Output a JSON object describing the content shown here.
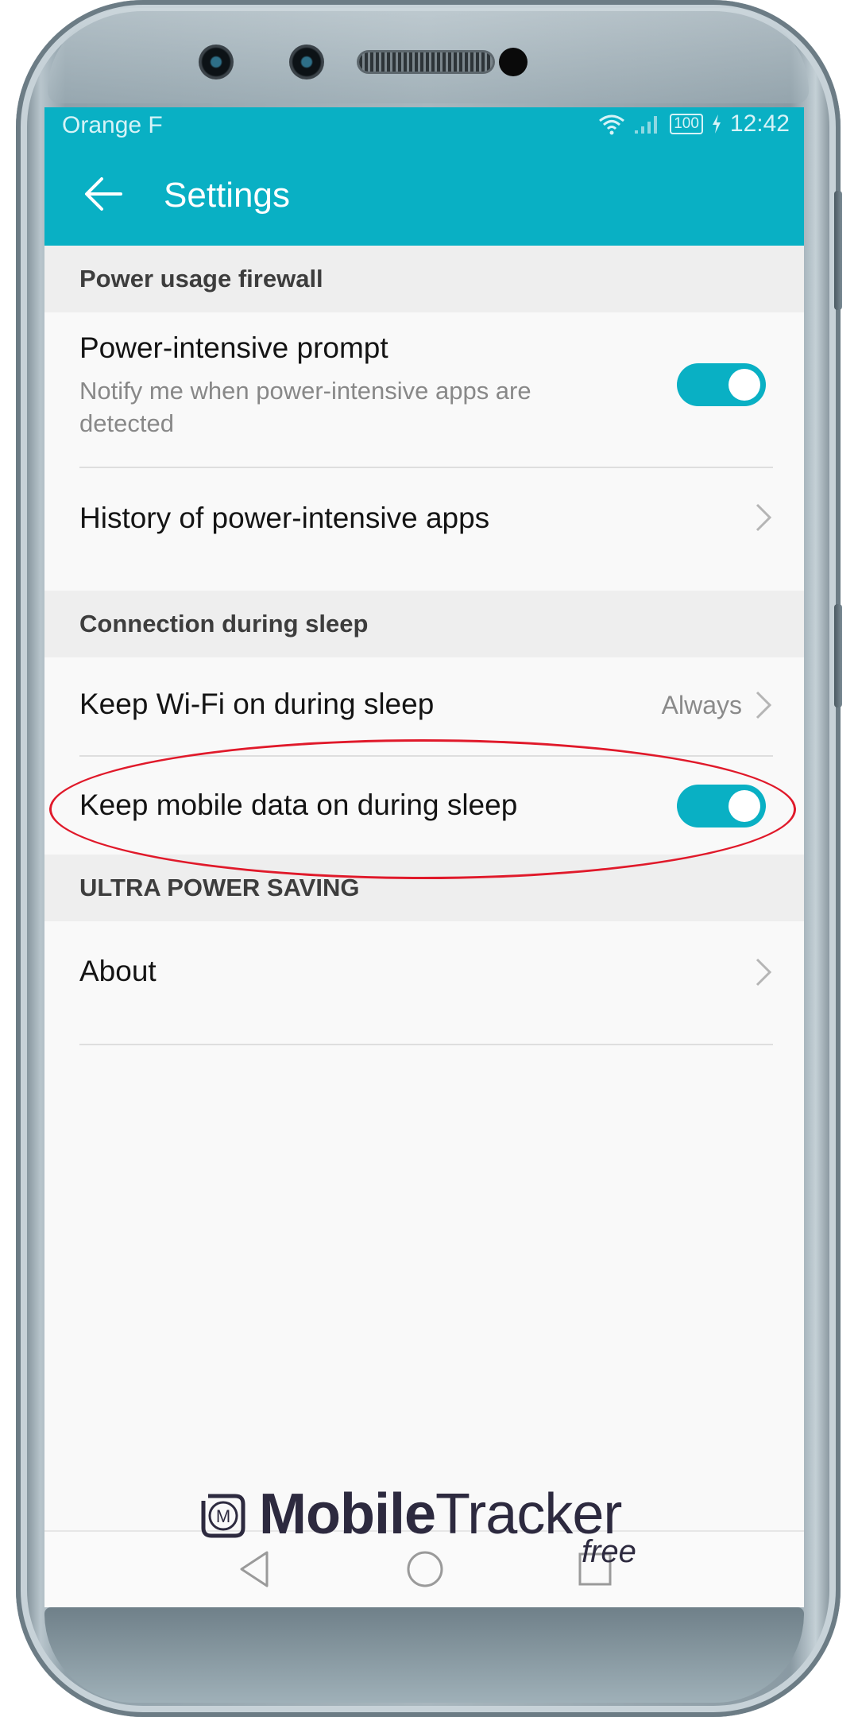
{
  "status_bar": {
    "carrier": "Orange F",
    "battery": "100",
    "time": "12:42",
    "icons": [
      "wifi-icon",
      "signal-icon",
      "battery-icon",
      "charging-icon"
    ]
  },
  "app_bar": {
    "title": "Settings",
    "back_icon": "back-arrow-icon"
  },
  "sections": {
    "power_usage_firewall": {
      "header": "Power usage firewall",
      "power_intensive_prompt": {
        "title": "Power-intensive prompt",
        "subtitle": "Notify me when power-intensive apps are detected",
        "toggle_on": true
      },
      "history": {
        "title": "History of power-intensive apps"
      }
    },
    "connection_during_sleep": {
      "header": "Connection during sleep",
      "wifi": {
        "title": "Keep Wi-Fi on during sleep",
        "value": "Always"
      },
      "mobile_data": {
        "title": "Keep mobile data on during sleep",
        "toggle_on": true
      }
    },
    "ultra_power_saving": {
      "header": "ULTRA POWER SAVING",
      "about": {
        "title": "About"
      }
    }
  },
  "nav_bar": {
    "icons": [
      "back-triangle-icon",
      "home-circle-icon",
      "recents-square-icon"
    ]
  },
  "watermark": {
    "logo_letter": "M",
    "brand_bold": "Mobile",
    "brand_light": "Tracker",
    "suffix": "free"
  },
  "colors": {
    "accent": "#09b0c4",
    "highlight": "#e0192a",
    "section_bg": "#eeeeee",
    "screen_bg": "#f9f9f9"
  }
}
